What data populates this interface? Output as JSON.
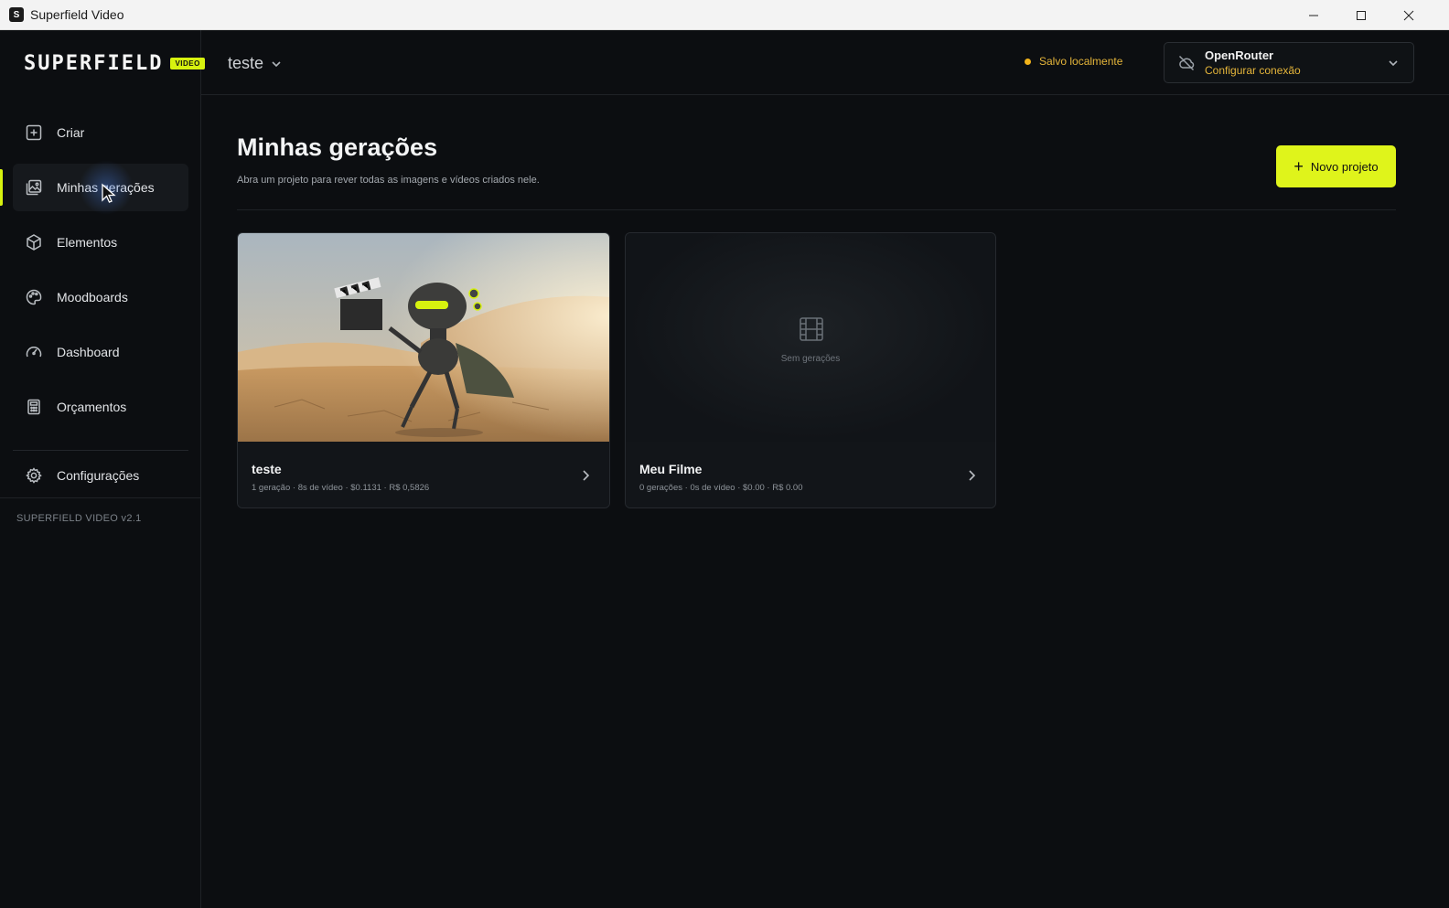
{
  "window": {
    "title": "Superfield Video",
    "app_icon": "superfield-logo"
  },
  "sidebar": {
    "brand": "SUPERFIELD",
    "brand_badge": "VIDEO",
    "items": [
      {
        "label": "Criar",
        "icon": "plus-square-icon"
      },
      {
        "label": "Minhas gerações",
        "icon": "gallery-icon",
        "active": true
      },
      {
        "label": "Elementos",
        "icon": "cube-icon"
      },
      {
        "label": "Moodboards",
        "icon": "palette-icon"
      },
      {
        "label": "Dashboard",
        "icon": "gauge-icon"
      },
      {
        "label": "Orçamentos",
        "icon": "calculator-icon"
      }
    ],
    "settings": {
      "label": "Configurações",
      "icon": "gear-icon"
    },
    "version": "SUPERFIELD VIDEO v2.1"
  },
  "header": {
    "project_name": "teste",
    "save_status": "Salvo localmente",
    "connection": {
      "provider": "OpenRouter",
      "action": "Configurar conexão"
    }
  },
  "main": {
    "title": "Minhas gerações",
    "subtitle": "Abra um projeto para rever todas as imagens e vídeos criados nele.",
    "new_project_label": "Novo projeto",
    "projects": [
      {
        "name": "teste",
        "meta": "1 geração · 8s de vídeo · $0.1131 · R$ 0,5826",
        "has_thumbnail": true
      },
      {
        "name": "Meu Filme",
        "meta": "0 gerações · 0s de vídeo · $0.00 · R$ 0.00",
        "has_thumbnail": false,
        "empty_label": "Sem gerações"
      }
    ]
  },
  "colors": {
    "accent": "#dff41b",
    "status_warning": "#e5b53a",
    "background": "#0c0e11"
  }
}
